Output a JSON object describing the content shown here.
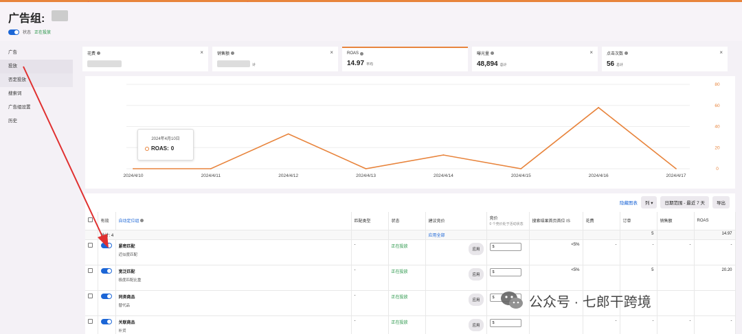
{
  "header": {
    "title": "广告组:",
    "status_label": "状态",
    "status_value": "正在投放"
  },
  "sidebar": {
    "items": [
      {
        "label": "广告"
      },
      {
        "label": "投放"
      },
      {
        "label": "否定投放"
      },
      {
        "label": "搜索词"
      },
      {
        "label": "广告组设置"
      },
      {
        "label": "历史"
      }
    ]
  },
  "metrics": [
    {
      "label": "花费",
      "value": "",
      "suffix": ""
    },
    {
      "label": "销售额",
      "value": "",
      "suffix": "计"
    },
    {
      "label": "ROAS",
      "value": "14.97",
      "suffix": "平均"
    },
    {
      "label": "曝光量",
      "value": "48,894",
      "suffix": "总计"
    },
    {
      "label": "点击次数",
      "value": "56",
      "suffix": "总计"
    }
  ],
  "chart_data": {
    "type": "line",
    "categories": [
      "2024/4/10",
      "2024/4/11",
      "2024/4/12",
      "2024/4/13",
      "2024/4/14",
      "2024/4/15",
      "2024/4/16",
      "2024/4/17"
    ],
    "series": [
      {
        "name": "ROAS",
        "values": [
          0,
          0,
          33,
          0,
          13,
          0,
          58,
          0
        ]
      }
    ],
    "yticks": [
      "80",
      "60",
      "40",
      "20",
      "0"
    ],
    "ylim": [
      0,
      80
    ],
    "color": "#e8843c",
    "grid": true
  },
  "tooltip": {
    "date": "2024年4月10日",
    "label": "ROAS:",
    "value": "0"
  },
  "toolbar": {
    "hide_chart": "隐藏图表",
    "columns": "列",
    "date_range": "日期范围 - 最近 7 天",
    "export": "导出"
  },
  "table": {
    "headers": {
      "active": "有效",
      "target": "自动定位组",
      "match": "匹配类型",
      "status": "状态",
      "suggested_bid": "建议竞价",
      "bid": "竞价",
      "bid_sub": "0 个竞价处于活动状态",
      "top_is": "搜索结果首页首位 IS",
      "spend": "花费",
      "orders": "订单",
      "sales": "销售额",
      "roas": "ROAS"
    },
    "total": {
      "label": "总计: 4",
      "apply_all": "应用全部",
      "orders": "5",
      "roas": "14.97"
    },
    "rows": [
      {
        "name": "紧密匹配",
        "sub": "近似度匹配",
        "match": "-",
        "status": "正在投放",
        "apply": "应用",
        "bid_prefix": "$",
        "top_is": "<5%",
        "spend": "-",
        "orders": "-",
        "sales": "-",
        "roas": "-"
      },
      {
        "name": "宽泛匹配",
        "sub": "极度匹配比重",
        "match": "-",
        "status": "正在投放",
        "apply": "应用",
        "bid_prefix": "$",
        "top_is": "<5%",
        "spend": "",
        "orders": "5",
        "sales": "",
        "roas": "20.20"
      },
      {
        "name": "同类商品",
        "sub": "替代品",
        "match": "-",
        "status": "正在投放",
        "apply": "应用",
        "bid_prefix": "$",
        "top_is": "",
        "spend": "",
        "orders": "",
        "sales": "",
        "roas": ""
      },
      {
        "name": "关联商品",
        "sub": "补货",
        "match": "-",
        "status": "正在投放",
        "apply": "应用",
        "bid_prefix": "$",
        "top_is": "",
        "spend": "-",
        "orders": "-",
        "sales": "-",
        "roas": "-"
      }
    ]
  },
  "watermark": {
    "text": "公众号 · 七郎干跨境"
  }
}
